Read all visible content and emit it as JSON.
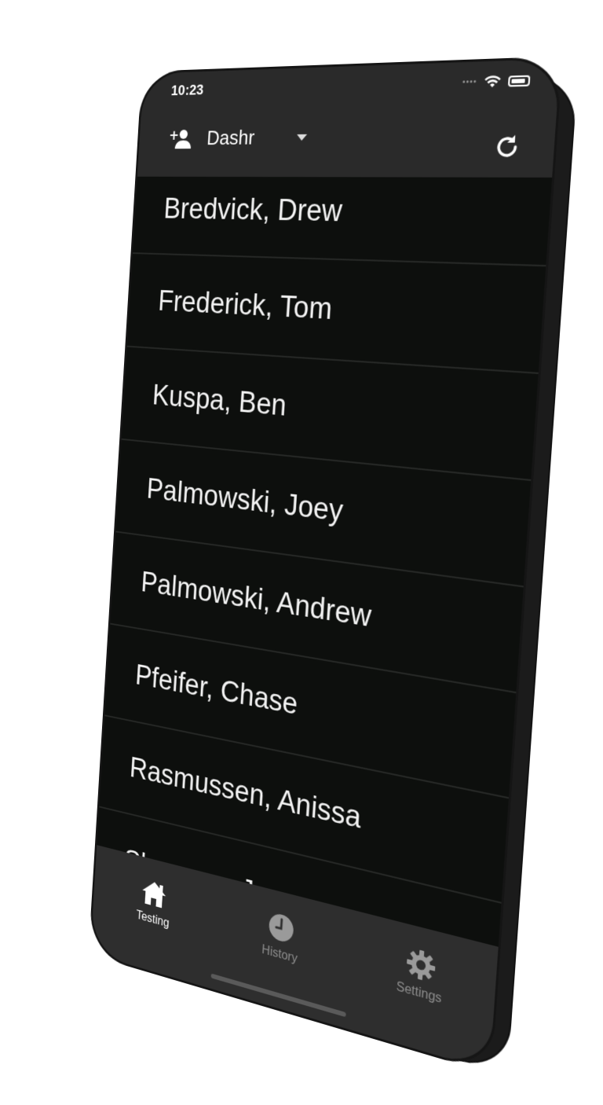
{
  "status_bar": {
    "time": "10:23",
    "signal_icon": "signal-dots",
    "wifi_icon": "wifi-icon",
    "battery_icon": "battery-icon"
  },
  "nav_bar": {
    "add_user_icon": "add-user-icon",
    "selected_user": "Dashr",
    "dropdown_icon": "caret-down-icon",
    "refresh_icon": "refresh-icon"
  },
  "athletes": [
    "Bredvick, Drew",
    "Frederick, Tom",
    "Kuspa, Ben",
    "Palmowski, Joey",
    "Palmowski, Andrew",
    "Pfeifer, Chase",
    "Rasmussen, Anissa",
    "Sherman, Jon"
  ],
  "tab_bar": {
    "tabs": [
      {
        "label": "Testing",
        "icon": "home-icon",
        "active": true
      },
      {
        "label": "History",
        "icon": "clock-icon",
        "active": false
      },
      {
        "label": "Settings",
        "icon": "gear-icon",
        "active": false
      }
    ]
  },
  "colors": {
    "screen_background": "#0d0f0d",
    "bar_background": "#2a2a2a",
    "tab_bar_background": "#2e2e2e",
    "text_primary": "#f2f2f2",
    "text_inactive": "#8e8e8e"
  }
}
